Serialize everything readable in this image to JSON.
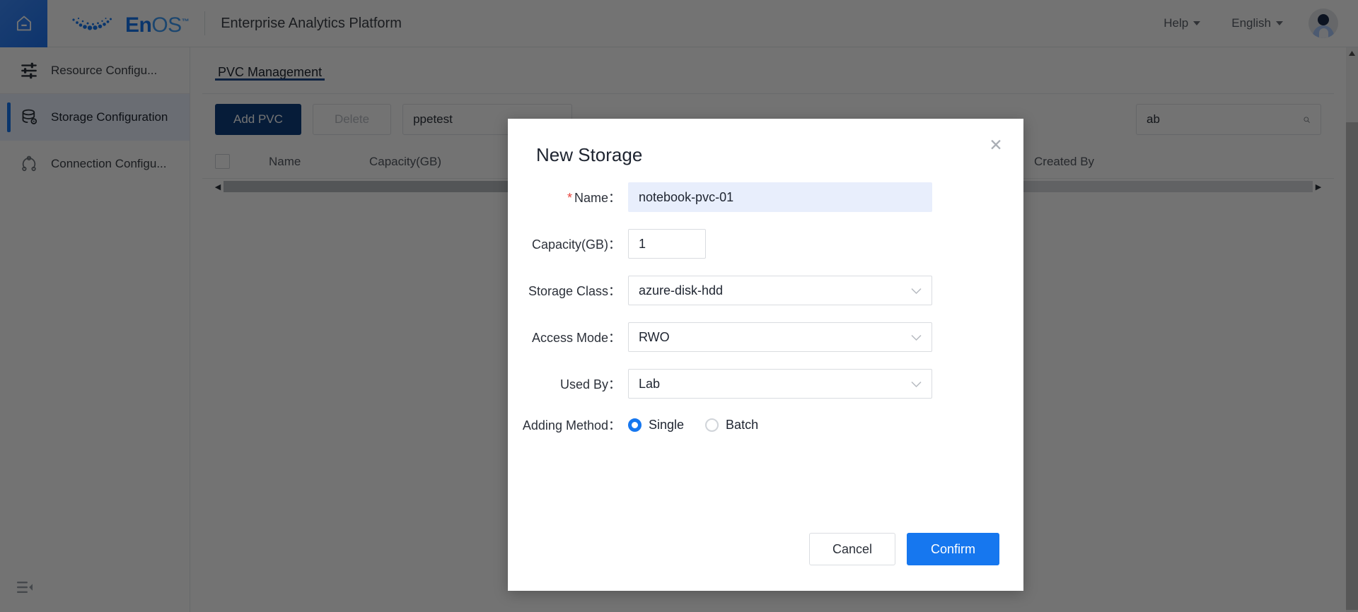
{
  "topbar": {
    "home_icon": "home-icon",
    "logo_en": "En",
    "logo_os": "OS",
    "logo_tm": "™",
    "app_title": "Enterprise Analytics Platform",
    "help_label": "Help",
    "language_label": "English",
    "avatar": "user-avatar"
  },
  "sidebar": {
    "items": [
      {
        "label": "Resource Configu...",
        "icon": "sliders-icon",
        "active": false
      },
      {
        "label": "Storage Configuration",
        "icon": "database-icon",
        "active": true
      },
      {
        "label": "Connection Configu...",
        "icon": "nodes-icon",
        "active": false
      }
    ],
    "collapse_icon": "collapse-sidebar-icon"
  },
  "main": {
    "tabs": [
      {
        "label": "PVC Management",
        "active": true
      }
    ],
    "toolbar": {
      "add_label": "Add PVC",
      "delete_label": "Delete",
      "namespace_value": "ppetest",
      "search_value": "ab",
      "search_placeholder": "",
      "search_icon": "search-icon"
    },
    "table": {
      "columns": [
        "Name",
        "Capacity(GB)",
        "Created By"
      ],
      "rows": []
    },
    "hscroll": {
      "left_arrow": "◀",
      "right_arrow": "▶"
    }
  },
  "modal": {
    "title": "New Storage",
    "close_icon": "✕",
    "fields": {
      "name": {
        "label": "Name",
        "value": "notebook-pvc-01",
        "required": true
      },
      "capacity": {
        "label": "Capacity(GB)",
        "value": "1",
        "required": false
      },
      "storage_class": {
        "label": "Storage Class",
        "value": "azure-disk-hdd",
        "required": false
      },
      "access_mode": {
        "label": "Access Mode",
        "value": "RWO",
        "required": false
      },
      "used_by": {
        "label": "Used By",
        "value": "Lab",
        "required": false
      }
    },
    "adding_method": {
      "label": "Adding Method",
      "options": [
        {
          "label": "Single",
          "checked": true
        },
        {
          "label": "Batch",
          "checked": false
        }
      ]
    },
    "cancel_label": "Cancel",
    "confirm_label": "Confirm"
  },
  "colors": {
    "brand_blue": "#1677ef",
    "dark_blue": "#0e3f7e",
    "accent_red": "#e8433c",
    "tab_underline": "#1f4d8f"
  }
}
